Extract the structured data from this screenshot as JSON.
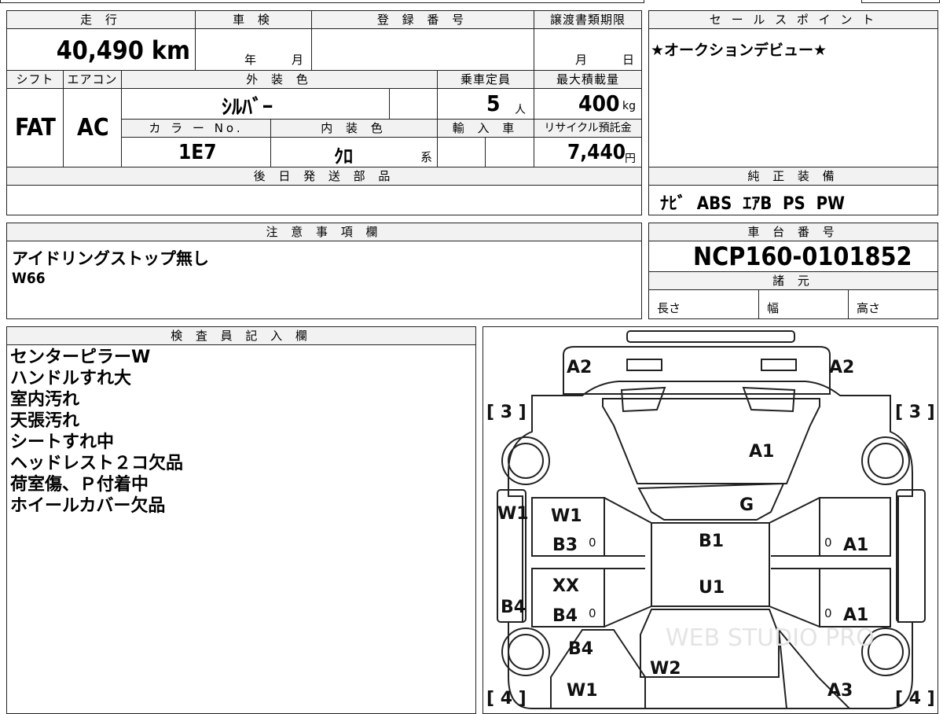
{
  "spec": {
    "mileage_label": "走 行",
    "mileage_value": "40,490 km",
    "inspection_label": "車 検",
    "inspection_year": "年",
    "inspection_month": "月",
    "registration_label": "登 録 番 号",
    "registration_value": "",
    "transfer_label": "譲渡書類期限",
    "transfer_month": "月",
    "transfer_day": "日",
    "shift_label": "シフト",
    "shift_value": "FAT",
    "ac_label": "エアコン",
    "ac_value": "AC",
    "exterior_color_label": "外 装 色",
    "exterior_color_value": "ｼﾙﾊﾞｰ",
    "capacity_label": "乗車定員",
    "capacity_value": "5",
    "capacity_unit": "人",
    "max_load_label": "最大積載量",
    "max_load_value": "400",
    "max_load_unit": "kg",
    "color_no_label": "カ ラ ー No.",
    "color_no_value": "1E7",
    "interior_color_label": "内 装 色",
    "interior_color_value": "ｸﾛ",
    "interior_color_suffix": "系",
    "import_label": "輸 入 車",
    "recycle_label": "リサイクル預託金",
    "recycle_value": "7,440",
    "recycle_unit": "円",
    "delivery_label": "後 日 発 送 部 品",
    "delivery_value": ""
  },
  "sales_points": {
    "label": "セ ー ル ス ポ イ ン ト",
    "text": "★オークションデビュー★"
  },
  "equipment": {
    "label": "純 正 装 備",
    "value": "ﾅﾋﾞ  ABS  ｴｱB  PS  PW"
  },
  "notes": {
    "label": "注 意 事 項 欄",
    "lines": [
      "アイドリングストップ無し",
      "W66"
    ]
  },
  "chassis": {
    "label": "車 台 番 号",
    "value": "NCP160-0101852"
  },
  "dimensions": {
    "label": "諸 元",
    "length_label": "長さ",
    "width_label": "幅",
    "height_label": "高さ"
  },
  "inspector": {
    "label": "検 査 員 記 入 欄",
    "lines": [
      "センターピラーW",
      "ハンドルすれ大",
      "室内汚れ",
      "天張汚れ",
      "シートすれ中",
      "ヘッドレスト２コ欠品",
      "荷室傷、Ｐ付着中",
      "ホイールカバー欠品"
    ]
  },
  "diagram": {
    "watermark": "WEB STUDIO PRO",
    "marks": {
      "front_left_corner": "A2",
      "front_right_corner": "A2",
      "left_bracket_top": "[ 3 ]",
      "right_bracket_top": "[ 3 ]",
      "hood": "A1",
      "windshield": "G",
      "left_rocker": "W1",
      "left_front_door": "W1",
      "left_front_door_2": "B3",
      "left_rear_door": "XX",
      "left_rear_door_2": "B4",
      "left_rocker_2": "B4",
      "roof": "B1",
      "roof_rear": "U1",
      "right_front_door": "A1",
      "right_rear_door": "A1",
      "rear_left_quarter": "B4",
      "rear_glass": "W2",
      "rear_left_corner": "W1",
      "rear_right_corner": "A3",
      "left_bracket_bottom": "[ 4 ]",
      "right_bracket_bottom": "[ 4 ]",
      "pillar_mark": "0"
    }
  }
}
